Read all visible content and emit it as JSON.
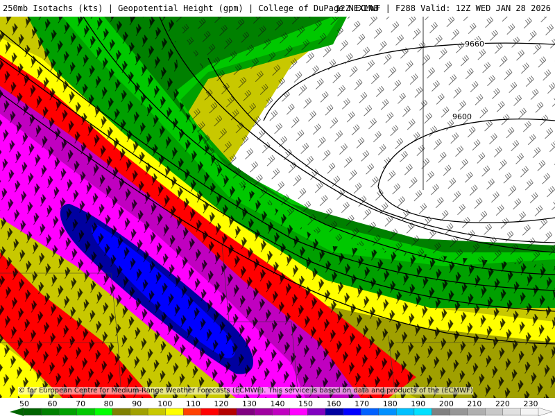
{
  "header": {
    "title_left": "250mb Isotachs (kts) | Geopotential Height (gpm) | College of DuPage NEXLAB",
    "title_right": "12Z ECMWF | F288 Valid: 12Z WED JAN 28 2026"
  },
  "map": {
    "height_contours": [
      {
        "label": "9660"
      },
      {
        "label": "9600"
      }
    ]
  },
  "copyright": "© for European Centre for Medium-Range Weather Forecasts (ECMWF). This service is based on data and products of the (ECMWF)",
  "colorbar": {
    "labels": [
      "50",
      "60",
      "70",
      "80",
      "90",
      "100",
      "110",
      "120",
      "130",
      "140",
      "150",
      "160",
      "170",
      "180",
      "190",
      "200",
      "210",
      "220",
      "230"
    ],
    "colors": [
      "#006400",
      "#008000",
      "#00a000",
      "#00c800",
      "#00ff00",
      "#7f8000",
      "#a0a000",
      "#c8c800",
      "#ffff00",
      "#ff4000",
      "#ff0000",
      "#b40000",
      "#800080",
      "#a000a0",
      "#c000c0",
      "#ff00ff",
      "#8000c0",
      "#0000a0",
      "#0000ff",
      "#0060ff",
      "#0090ff",
      "#00c0ff",
      "#00e0ff",
      "#808080",
      "#969696",
      "#afafaf",
      "#c8c8c8",
      "#e0e0e0",
      "#f4f4f4"
    ]
  }
}
